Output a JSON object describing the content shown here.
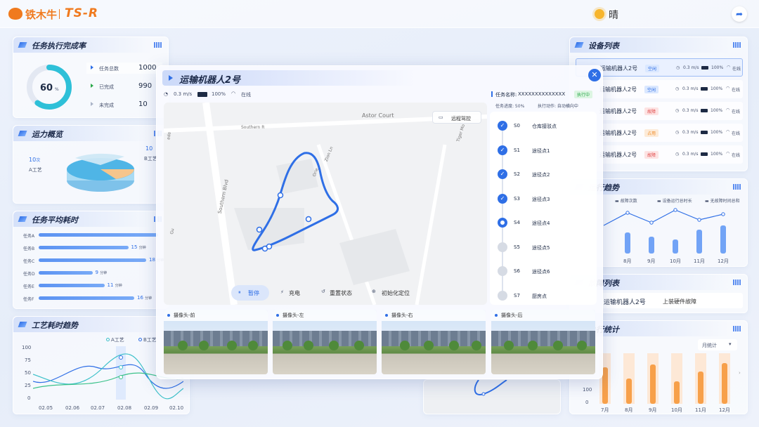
{
  "header": {
    "brand": "铁木牛",
    "product": "TS-R",
    "weather": "晴"
  },
  "task_completion": {
    "title": "任务执行完成率",
    "percent": "60",
    "percent_unit": "%",
    "progress": 0.6,
    "rows": [
      {
        "label": "任务总数",
        "value": "1000"
      },
      {
        "label": "已完成",
        "value": "990"
      },
      {
        "label": "未完成",
        "value": "10"
      }
    ]
  },
  "capacity": {
    "title": "运力概览",
    "left_value": "10",
    "left_unit": "次",
    "left_label": "A工艺",
    "right_value": "10",
    "right_label": "B工艺"
  },
  "avg_time": {
    "title": "任务平均耗时",
    "unit": "分钟",
    "rows": [
      {
        "label": "任务A",
        "value": ""
      },
      {
        "label": "任务B",
        "value": "15"
      },
      {
        "label": "任务C",
        "value": "18"
      },
      {
        "label": "任务D",
        "value": "9"
      },
      {
        "label": "任务E",
        "value": "11"
      },
      {
        "label": "任务F",
        "value": "16"
      }
    ]
  },
  "process_trend": {
    "title": "工艺耗时趋势",
    "legend": [
      "A工艺",
      "B工艺"
    ],
    "yticks": [
      "100",
      "75",
      "50",
      "25",
      "0"
    ],
    "xticks": [
      "02.05",
      "02.06",
      "02.07",
      "02.08",
      "02.09",
      "02.10"
    ]
  },
  "device_list": {
    "title": "设备列表",
    "rows": [
      {
        "name": "运输机器人2号",
        "status": "空闲",
        "speed": "0.3 m/s",
        "battery": "100%",
        "net": "在线"
      },
      {
        "name": "运输机器人2号",
        "status": "空闲",
        "speed": "0.3 m/s",
        "battery": "100%",
        "net": "在线"
      },
      {
        "name": "运输机器人2号",
        "status": "故障",
        "speed": "0.3 m/s",
        "battery": "100%",
        "net": "在线"
      },
      {
        "name": "运输机器人2号",
        "status": "占用",
        "speed": "0.3 m/s",
        "battery": "100%",
        "net": "在线"
      },
      {
        "name": "运输机器人2号",
        "status": "故障",
        "speed": "0.3 m/s",
        "battery": "100%",
        "net": "在线"
      }
    ]
  },
  "run_trend": {
    "title": "运行趋势",
    "legend": [
      "故障次数",
      "设备运行总时长",
      "无故障时间总和"
    ],
    "xticks": [
      "8月",
      "9月",
      "10月",
      "11月",
      "12月"
    ]
  },
  "fault_list": {
    "title": "故障列表",
    "device": "运输机器人2号",
    "fault": "上装硬件故障"
  },
  "exec_stats": {
    "title": "执行统计",
    "period": "月统计",
    "yticks": [
      "100",
      "0"
    ],
    "xticks": [
      "7月",
      "8月",
      "9月",
      "10月",
      "11月",
      "12月"
    ]
  },
  "modal": {
    "title": "运输机器人2号",
    "speed": "0.3 m/s",
    "battery": "100%",
    "net": "在线",
    "task_name_label": "任务名称:",
    "task_name": "XXXXXXXXXXXXXX",
    "task_status": "执行中",
    "progress_text": "任务进度: 50%",
    "action_text": "执行动作: 自动横向中",
    "remote_button": "远程驾控",
    "map_labels": [
      "Astor Court",
      "Southern R",
      "Southern Blvd",
      "Zion Ln",
      "Tiger Mo",
      "Orie",
      "Gu",
      "ade"
    ],
    "controls": [
      "暂停",
      "充电",
      "重置状态",
      "初始化定位"
    ],
    "steps": [
      {
        "id": "S0",
        "label": "仓库接驳点",
        "state": "done"
      },
      {
        "id": "S1",
        "label": "途径点1",
        "state": "done"
      },
      {
        "id": "S2",
        "label": "途径点2",
        "state": "done"
      },
      {
        "id": "S3",
        "label": "途径点3",
        "state": "done"
      },
      {
        "id": "S4",
        "label": "途径点4",
        "state": "current"
      },
      {
        "id": "S5",
        "label": "途径点5",
        "state": "todo"
      },
      {
        "id": "S6",
        "label": "途径点6",
        "state": "todo"
      },
      {
        "id": "S7",
        "label": "厨房点",
        "state": "todo"
      }
    ],
    "cameras": [
      "摄像头-前",
      "摄像头-左",
      "摄像头-右",
      "摄像头-后"
    ]
  },
  "colors": {
    "primary": "#2f6fe6",
    "brand": "#f07a1e",
    "teal": "#3cc1c9",
    "orange": "#f7a04a"
  }
}
